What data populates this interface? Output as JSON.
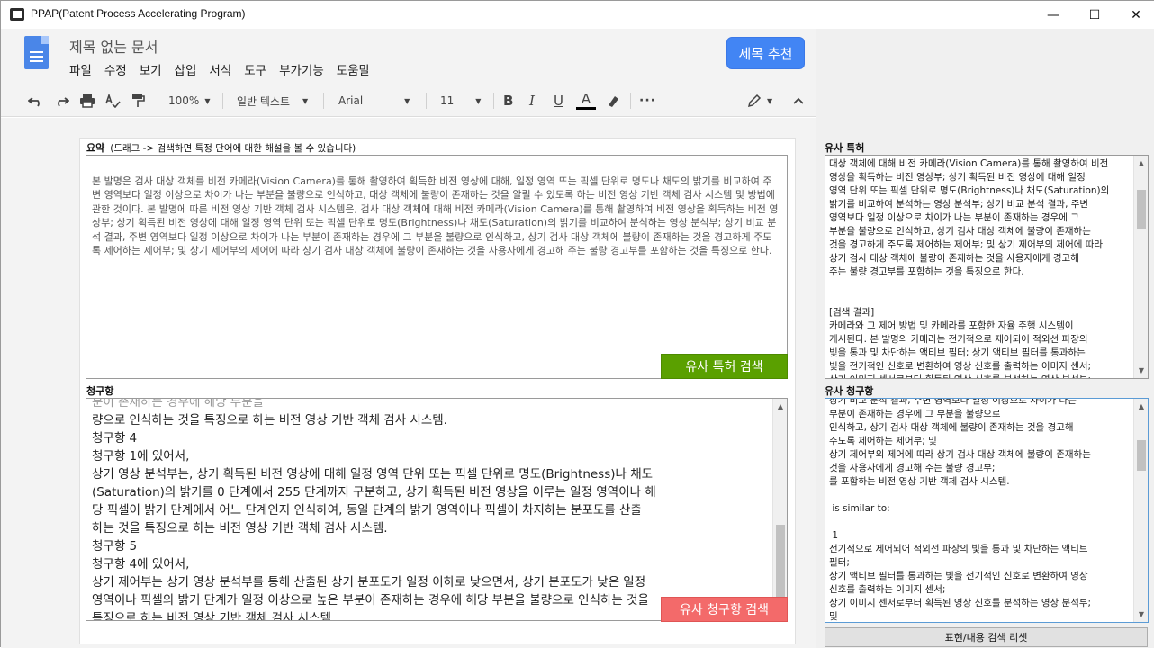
{
  "window": {
    "title": "PPAP(Patent Process Accelerating Program)",
    "controls": [
      "—",
      "☐",
      "✕"
    ]
  },
  "docs": {
    "title": "제목 없는 문서",
    "menus": [
      "파일",
      "수정",
      "보기",
      "삽입",
      "서식",
      "도구",
      "부가기능",
      "도움말"
    ],
    "recommend_label": "제목 추천"
  },
  "toolbar": {
    "zoom": "100%",
    "style": "일반 텍스트",
    "font": "Arial",
    "size": "11",
    "underline_color": "#000000"
  },
  "summary": {
    "label": "요약",
    "hint": "(드래그 -> 검색하면 특정 단어에 대한 해설을 볼 수 있습니다)",
    "text": "본 발명은 검사 대상 객체를 비전 카메라(Vision Camera)를 통해 촬영하여 획득한 비전 영상에 대해, 일정 영역 또는 픽셀 단위로 명도나 채도의 밝기를 비교하여 주변 영역보다 일정 이상으로 차이가 나는 부분을 불량으로 인식하고, 대상 객체에 불량이 존재하는 것을 알릴 수 있도록 하는 비전 영상 기반 객체 검사 시스템 및 방법에 관한 것이다. 본 발명에 따른 비전 영상 기반 객체 검사 시스템은, 검사 대상 객체에 대해 비전 카메라(Vision Camera)를 통해 촬영하여 비전 영상을 획득하는 비전 영상부; 상기 획득된 비전 영상에 대해 일정 영역 단위 또는 픽셀 단위로 명도(Brightness)나 채도(Saturation)의 밝기를 비교하여 분석하는 영상 분석부; 상기 비교 분석 결과, 주변 영역보다 일정 이상으로 차이가 나는 부분이 존재하는 경우에 그 부분을 불량으로 인식하고, 상기 검사 대상 객체에 불량이 존재하는 것을 경고하게 주도록 제어하는 제어부; 및 상기 제어부의 제어에 따라 상기 검사 대상 객체에 불량이 존재하는 것을 사용자에게 경고해 주는 불량 경고부를 포함하는 것을 특징으로 한다.",
    "search_button": "유사 특허 검색"
  },
  "claims": {
    "label": "청구항",
    "lines": [
      "분이 존재하는 경우에 해당 부분을",
      "량으로 인식하는 것을 특징으로 하는 비전 영상 기반 객체 검사 시스템.",
      "청구항 4",
      "청구항 1에 있어서,",
      "상기 영상 분석부는, 상기 획득된 비전 영상에 대해 일정 영역 단위 또는 픽셀 단위로 명도(Brightness)나 채도",
      "(Saturation)의 밝기를 0 단계에서 255 단계까지 구분하고, 상기 획득된 비전 영상을 이루는 일정 영역이나 해",
      "당 픽셀이 밝기 단계에서 어느 단계인지 인식하여, 동일 단계의 밝기 영역이나 픽셀이 차지하는 분포도를 산출",
      "하는 것을 특징으로 하는 비전 영상 기반 객체 검사 시스템.",
      "청구항 5",
      "청구항 4에 있어서,",
      "상기 제어부는 상기 영상 분석부를 통해 산출된 상기 분포도가 일정 이하로 낮으면서, 상기 분포도가 낮은 일정",
      "영역이나 픽셀의 밝기 단계가 일정 이상으로 높은 부분이 존재하는 경우에 해당 부분을 불량으로 인식하는 것을",
      "특징으로 하는 비전 영상 기반 객체 검사 시스템."
    ],
    "search_button": "유사 청구항 검색"
  },
  "similar_patents": {
    "label": "유사 특허",
    "text": "대상 객체에 대해 비전 카메라(Vision Camera)를 통해 촬영하여 비전\n영상을 획득하는 비전 영상부; 상기 획득된 비전 영상에 대해 일정\n영역 단위 또는 픽셀 단위로 명도(Brightness)나 채도(Saturation)의\n밝기를 비교하여 분석하는 영상 분석부; 상기 비교 분석 결과, 주변\n영역보다 일정 이상으로 차이가 나는 부분이 존재하는 경우에 그\n부분을 불량으로 인식하고, 상기 검사 대상 객체에 불량이 존재하는\n것을 경고하게 주도록 제어하는 제어부; 및 상기 제어부의 제어에 따라\n상기 검사 대상 객체에 불량이 존재하는 것을 사용자에게 경고해\n주는 불량 경고부를 포함하는 것을 특징으로 한다.\n\n\n[검색 결과]\n카메라와 그 제어 방법 및 카메라를 포함한 자율 주행 시스템이\n개시된다. 본 발명의 카메라는 전기적으로 제어되어 적외선 파장의\n빛을 통과 및 차단하는 액티브 필터; 상기 액티브 필터를 통과하는\n빛을 전기적인 신호로 변환하여 영상 신호를 출력하는 이미지 센서;\n상기 이미지 센서로부터 획득된 영상 신호를 분석하는 영상 분석부;"
  },
  "similar_claims": {
    "label": "유사 청구항",
    "text": "상기 비교 분석 결과, 주변 영역보다 일정 이상으로 차이가 나는\n부분이 존재하는 경우에 그 부분을 불량으로\n인식하고, 상기 검사 대상 객체에 불량이 존재하는 것을 경고해\n주도록 제어하는 제어부; 및\n상기 제어부의 제어에 따라 상기 검사 대상 객체에 불량이 존재하는\n것을 사용자에게 경고해 주는 불량 경고부;\n를 포함하는 비전 영상 기반 객체 검사 시스템.\n\n is similar to:\n\n 1\n전기적으로 제어되어 적외선 파장의 빛을 통과 및 차단하는 액티브\n필터;\n상기 액티브 필터를 통과하는 빛을 전기적인 신호로 변환하여 영상\n신호를 출력하는 이미지 센서;\n상기 이미지 센서로부터 획득된 영상 신호를 분석하는 영상 분석부;\n및\n상기 영상 신호의 분석 결과를 바탕으로 상기 액티브 필터의 동작"
  },
  "reset_button": "표현/내용 검색 리셋"
}
